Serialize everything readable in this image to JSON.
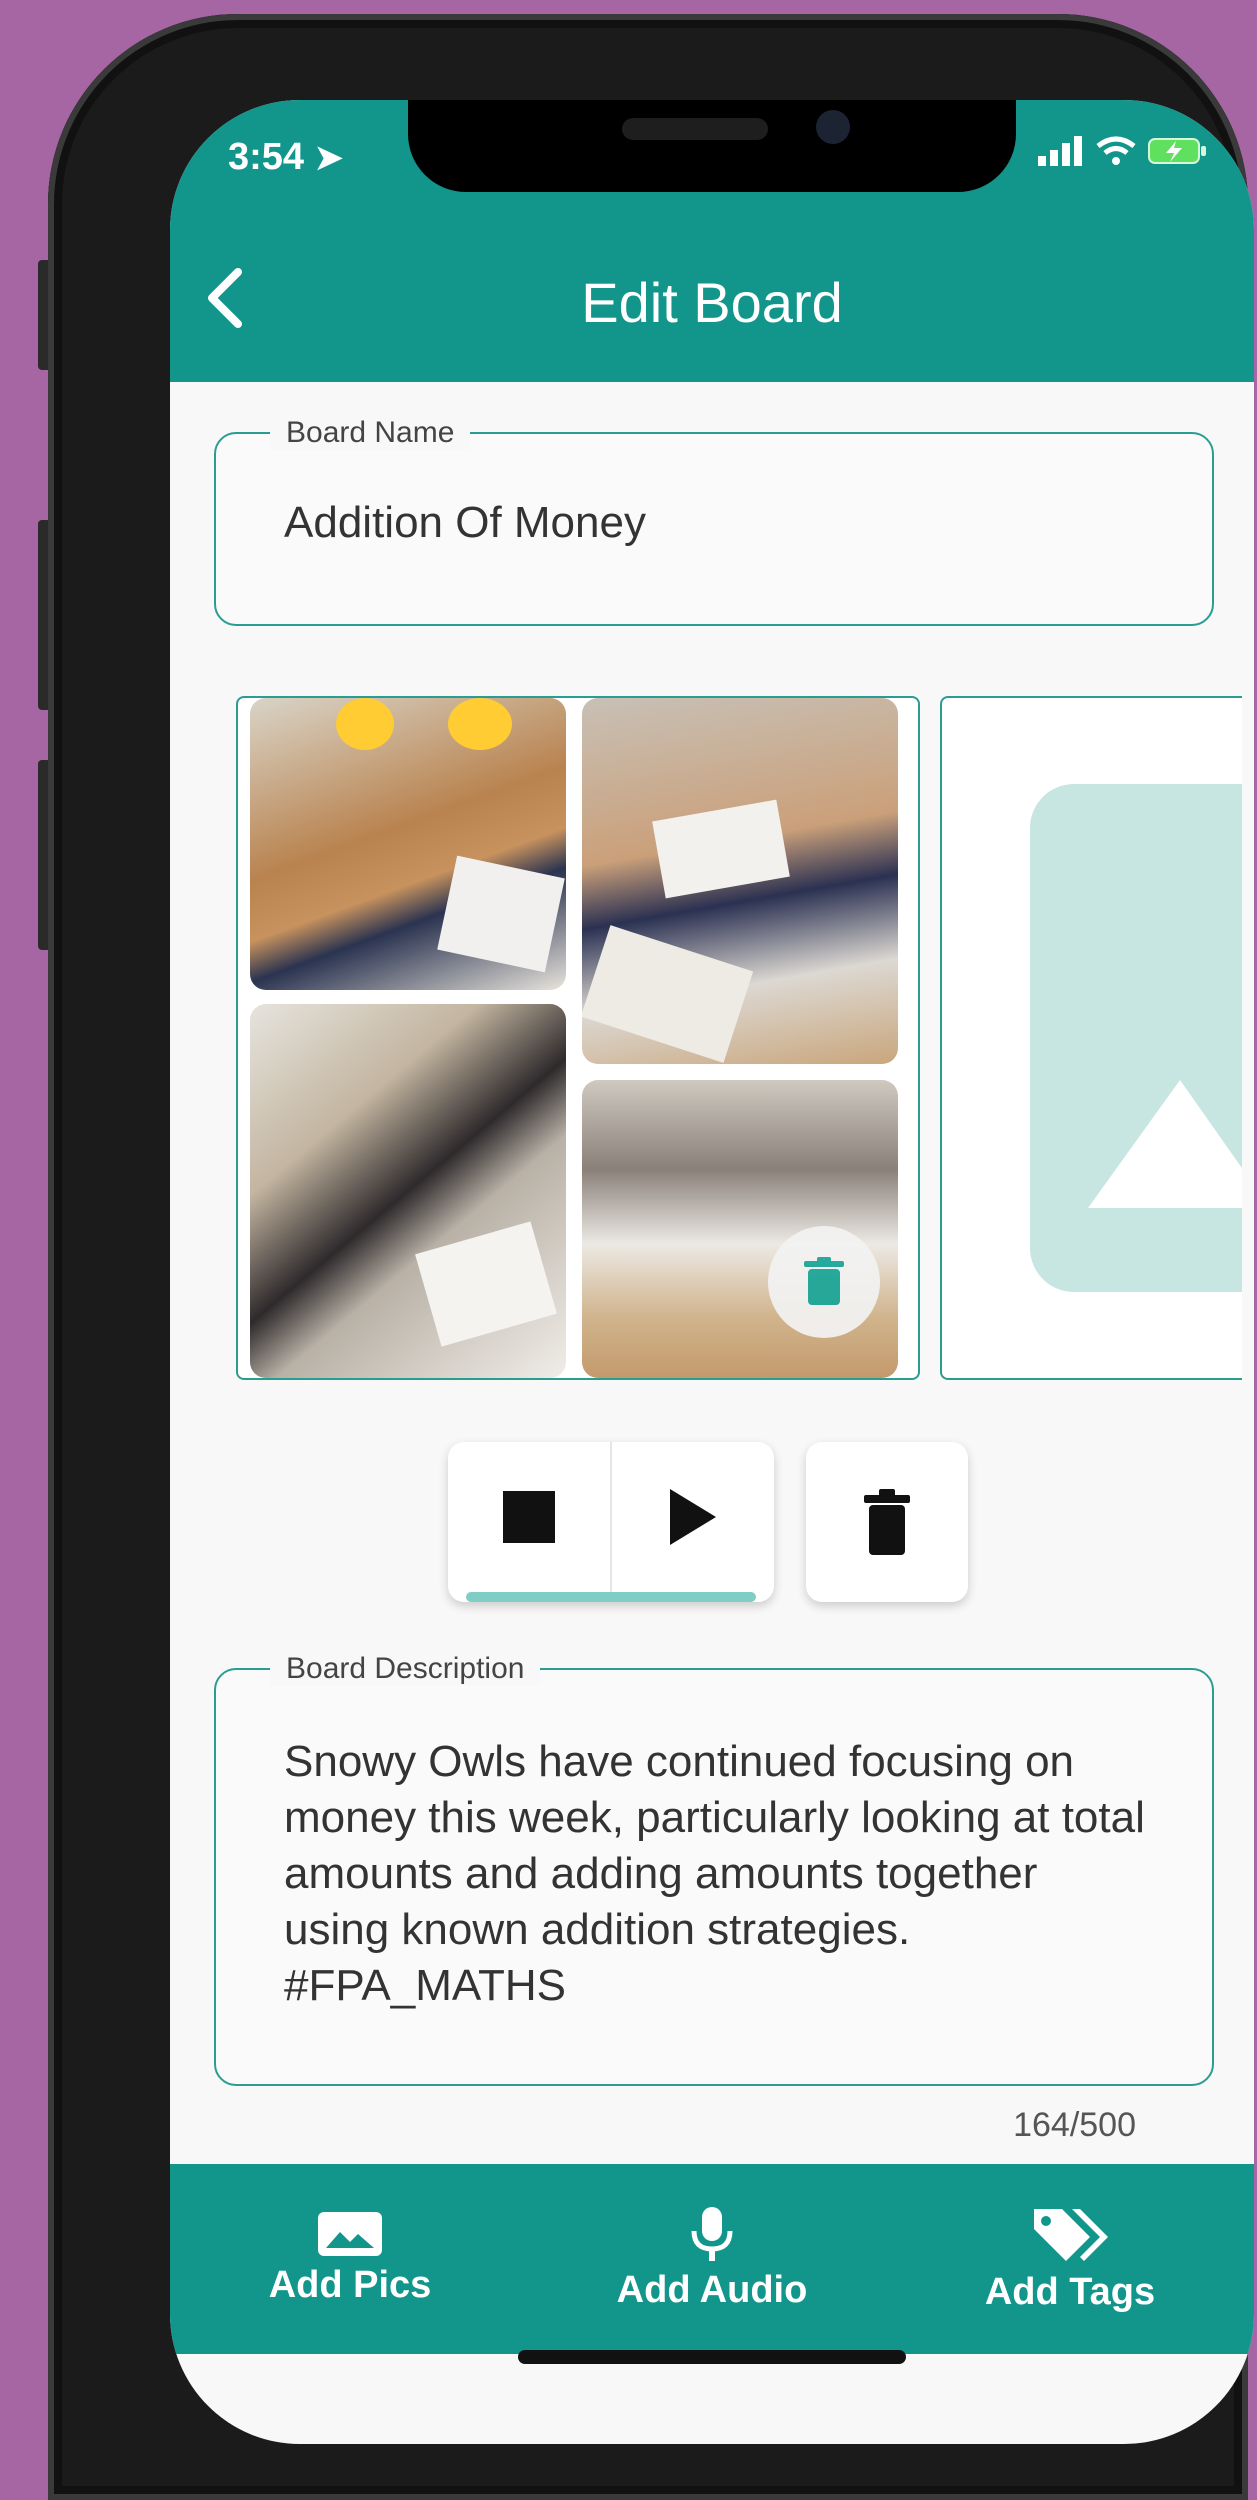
{
  "status": {
    "time": "3:54"
  },
  "header": {
    "title": "Edit Board"
  },
  "board_name": {
    "label": "Board Name",
    "value": "Addition Of Money"
  },
  "board_description": {
    "label": "Board Description",
    "value": "Snowy Owls have continued focusing on money this week, particularly looking at total amounts and adding amounts together using known addition strategies. #FPA_MATHS",
    "char_count": "164/500"
  },
  "bottom_tabs": [
    {
      "label": "Add Pics",
      "icon": "image-icon"
    },
    {
      "label": "Add Audio",
      "icon": "microphone-icon"
    },
    {
      "label": "Add Tags",
      "icon": "tag-icon"
    }
  ],
  "colors": {
    "primary": "#12968c",
    "accent_border": "#2a9d93",
    "placeholder": "#c7e5e1",
    "background": "#a666a3"
  }
}
